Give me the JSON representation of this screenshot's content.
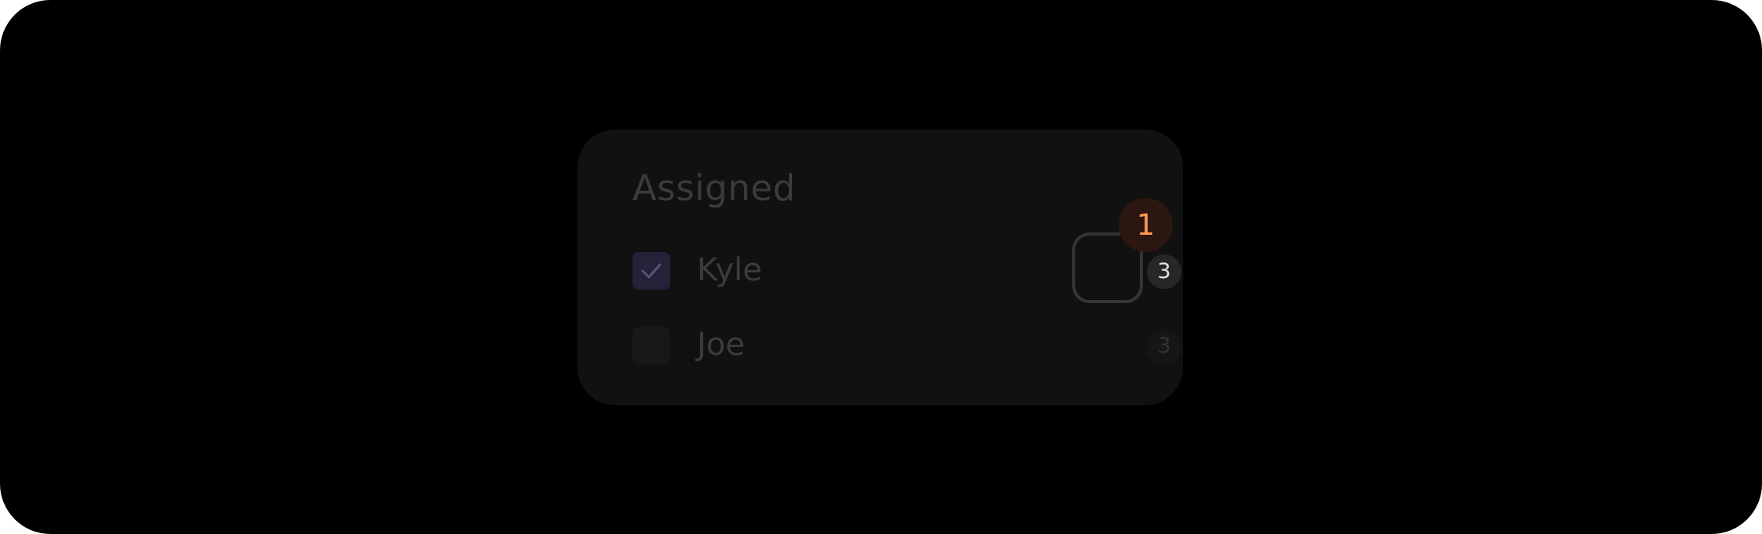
{
  "panel": {
    "title": "Assigned",
    "items": [
      {
        "label": "Kyle",
        "checked": true,
        "count": "3"
      },
      {
        "label": "Joe",
        "checked": false,
        "count": "3"
      }
    ]
  },
  "annotation": {
    "step_number": "1"
  },
  "colors": {
    "background": "#000000",
    "panel": "#111111",
    "checkbox_checked": "#242139",
    "step_marker_text": "#ff9a55"
  }
}
